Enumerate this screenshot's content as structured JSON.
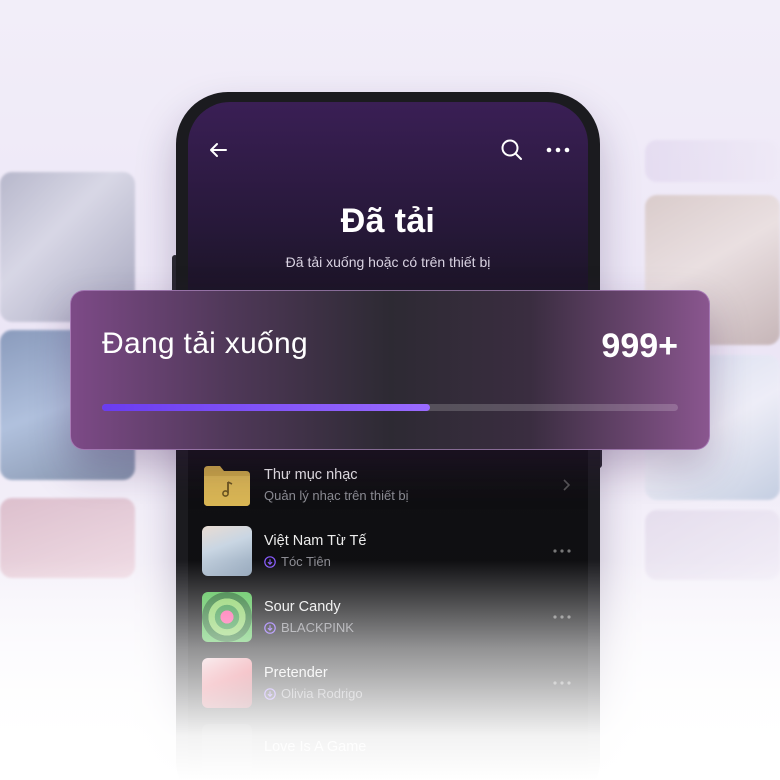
{
  "header": {
    "title": "Đã tải",
    "subtitle": "Đã tải xuống hoặc có trên thiết bị"
  },
  "download_card": {
    "label": "Đang tải xuống",
    "count": "999+",
    "progress_fraction": 0.57
  },
  "list": {
    "folder": {
      "title": "Thư mục nhạc",
      "subtitle": "Quản lý nhạc trên thiết bị"
    },
    "songs": [
      {
        "title": "Việt Nam Từ Tế",
        "artist": "Tóc Tiên"
      },
      {
        "title": "Sour Candy",
        "artist": "BLACKPINK"
      },
      {
        "title": "Pretender",
        "artist": "Olivia Rodrigo"
      },
      {
        "title": "Love Is A Game",
        "artist": ""
      }
    ]
  },
  "icons": {
    "back": "arrow-left-icon",
    "search": "search-icon",
    "more": "more-horizontal-icon",
    "folder": "music-folder-icon",
    "downloaded": "download-circle-icon"
  },
  "colors": {
    "accent": "#7b4dff",
    "folder": "#c9a646"
  }
}
